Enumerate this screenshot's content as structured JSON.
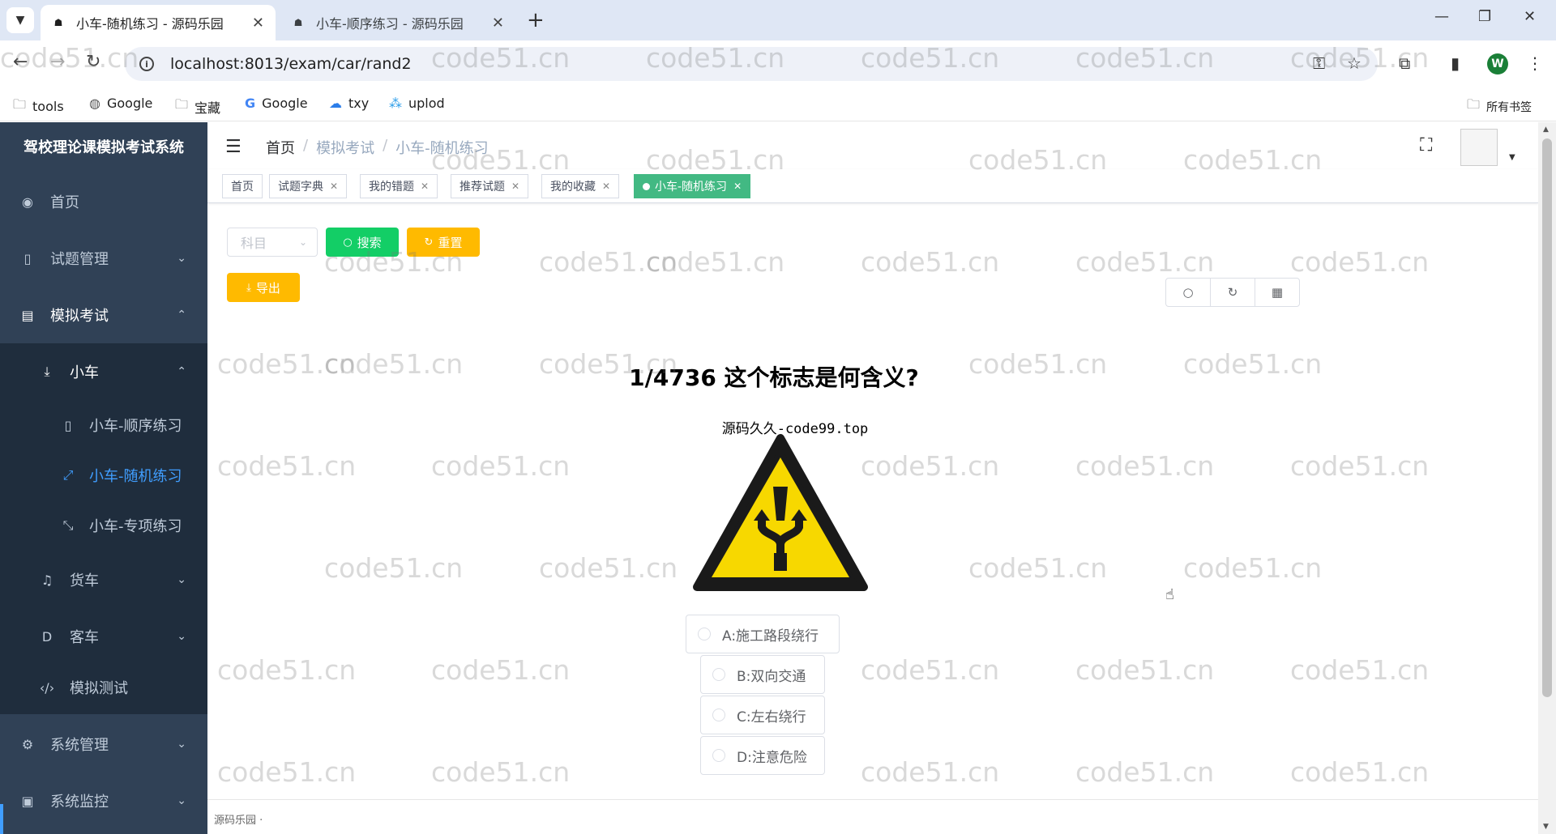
{
  "browser": {
    "tabs": [
      {
        "title": "小车-随机练习 - 源码乐园",
        "active": true
      },
      {
        "title": "小车-顺序练习 - 源码乐园",
        "active": false
      }
    ],
    "url": "localhost:8013/exam/car/rand2",
    "profile_initial": "W",
    "bookmarks": [
      "tools",
      "Google",
      "宝藏",
      "Google",
      "txy",
      "uplod"
    ],
    "all_bookmarks": "所有书签"
  },
  "sidebar": {
    "title": "驾校理论课模拟考试系统",
    "items": [
      {
        "label": "首页",
        "icon": "dashboard-icon"
      },
      {
        "label": "试题管理",
        "icon": "book-icon"
      },
      {
        "label": "模拟考试",
        "icon": "list-icon"
      },
      {
        "label": "小车",
        "icon": "download-icon"
      },
      {
        "label": "小车-顺序练习",
        "icon": "book-icon"
      },
      {
        "label": "小车-随机练习",
        "icon": "expand-icon"
      },
      {
        "label": "小车-专项练习",
        "icon": "compress-icon"
      },
      {
        "label": "货车",
        "icon": "bell-icon"
      },
      {
        "label": "客车",
        "icon": "d-icon"
      },
      {
        "label": "模拟测试",
        "icon": "code-icon"
      },
      {
        "label": "系统管理",
        "icon": "gear-icon"
      },
      {
        "label": "系统监控",
        "icon": "monitor-icon"
      }
    ]
  },
  "navbar": {
    "breadcrumb": [
      "首页",
      "模拟考试",
      "小车-随机练习"
    ]
  },
  "tags": [
    "首页",
    "试题字典",
    "我的错题",
    "推荐试题",
    "我的收藏",
    "小车-随机练习"
  ],
  "toolbar": {
    "subject_placeholder": "科目",
    "search_label": "搜索",
    "reset_label": "重置",
    "export_label": "导出"
  },
  "question": {
    "title": "1/4736 这个标志是何含义?",
    "image_caption": "源码久久-code99.top",
    "options": [
      "A:施工路段绕行",
      "B:双向交通",
      "C:左右绕行",
      "D:注意危险"
    ]
  },
  "footer": {
    "text": "源码乐园 ·"
  },
  "watermark": "code51.cn"
}
